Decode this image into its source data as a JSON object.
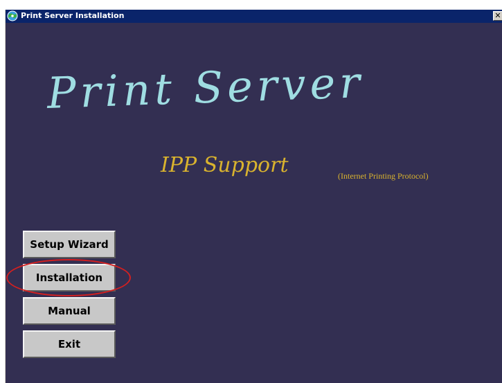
{
  "window": {
    "title": "Print Server Installation",
    "title_icon": "cd-globe-icon",
    "close_label": "✕"
  },
  "brand": {
    "title": "Print Server",
    "subtitle": "IPP Support",
    "protocol": "(Internet Printing Protocol)"
  },
  "menu": {
    "buttons": [
      {
        "label": "Setup Wizard"
      },
      {
        "label": "Installation",
        "highlighted": true
      },
      {
        "label": "Manual"
      },
      {
        "label": "Exit"
      }
    ]
  },
  "colors": {
    "titlebar": "#0a246a",
    "background": "#332f52",
    "title_script": "#9fdde2",
    "subtitle_script": "#d9b32e",
    "button_face": "#c8c8c8",
    "highlight_ring": "#d42020"
  }
}
